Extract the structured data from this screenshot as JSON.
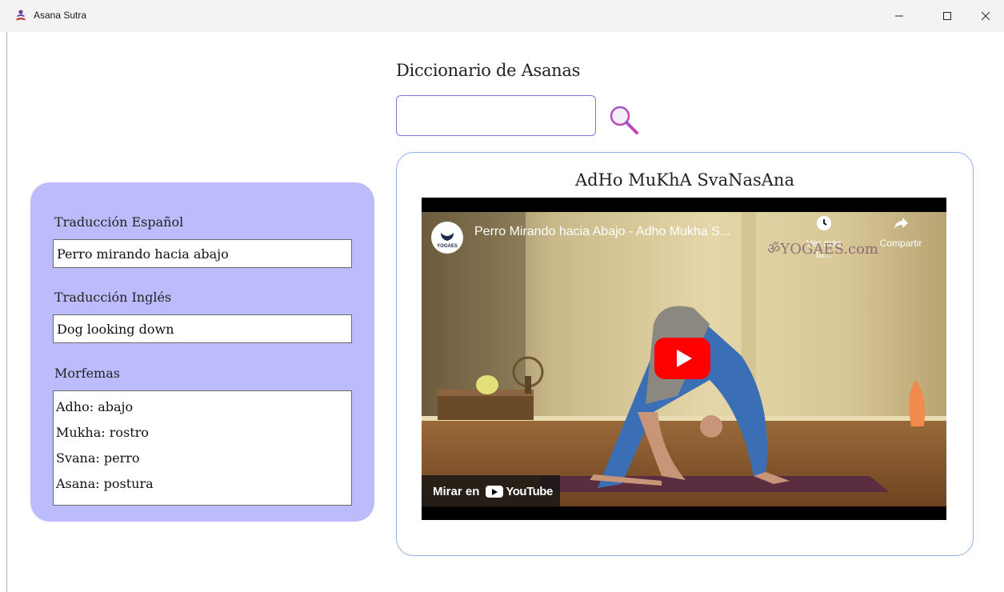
{
  "window": {
    "title": "Asana Sutra",
    "icon": "meditation-icon"
  },
  "header": {
    "title": "Diccionario de Asanas"
  },
  "search": {
    "value": "",
    "placeholder": "",
    "icon": "search-icon",
    "icon_color": "#b24bd6"
  },
  "details": {
    "spanish_label": "Traducción Español",
    "spanish_value": "Perro mirando hacia abajo",
    "english_label": "Traducción Inglés",
    "english_value": "Dog looking down",
    "morphemes_label": "Morfemas",
    "morphemes": [
      "Adho: abajo",
      "Mukha: rostro",
      "Svana: perro",
      "Asana: postura"
    ],
    "panel_color": "#bcbcfc"
  },
  "video": {
    "asana_name": "AdHo MuKhA SvaNasAna",
    "title": "Perro Mirando hacia Abajo - Adho Mukha S...",
    "channel": "YOGAES",
    "watch_later": "Ver más ta...",
    "share": "Compartir",
    "watermark": "YOGAES.com",
    "watch_on": "Mirar en",
    "brand": "YouTube",
    "play_color": "#ff0000"
  }
}
